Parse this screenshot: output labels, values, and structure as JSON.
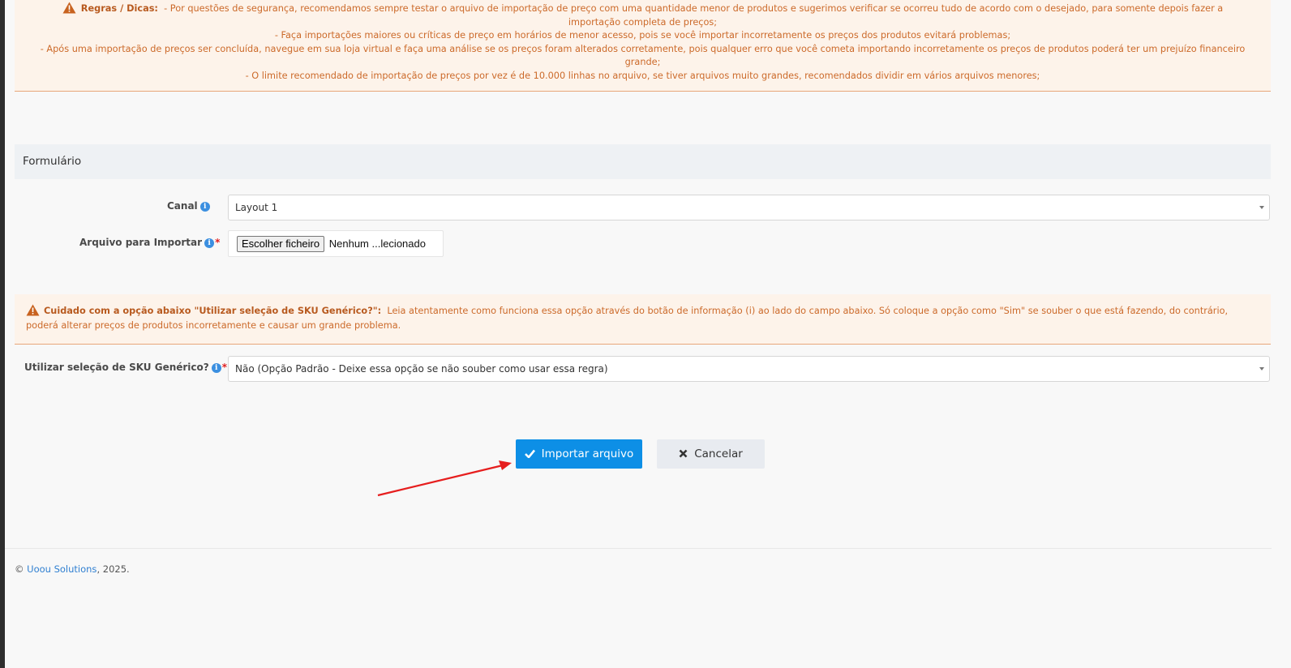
{
  "rules": {
    "title": "Regras / Dicas:",
    "lines": [
      "- Por questões de segurança, recomendamos sempre testar o arquivo de importação de preço com uma quantidade menor de produtos e sugerimos verificar se ocorreu tudo de acordo com o desejado, para somente depois fazer a importação completa de preços;",
      "- Faça importações maiores ou críticas de preço em horários de menor acesso, pois se você importar incorretamente os preços dos produtos evitará problemas;",
      "- Após uma importação de preços ser concluída, navegue em sua loja virtual e faça uma análise se os preços foram alterados corretamente, pois qualquer erro que você cometa importando incorretamente os preços de produtos poderá ter um prejuízo financeiro grande;",
      "- O limite recomendado de importação de preços por vez é de 10.000 linhas no arquivo, se tiver arquivos muito grandes, recomendados dividir em vários arquivos menores;"
    ]
  },
  "section": {
    "title": "Formulário"
  },
  "form": {
    "canal_label": "Canal",
    "canal_value": "Layout 1",
    "arquivo_label": "Arquivo para Importar",
    "file_button": "Escolher ficheiro",
    "file_status": "Nenhum ...lecionado",
    "required_mark": "*",
    "info_glyph": "i",
    "sku_label": "Utilizar seleção de SKU Genérico?",
    "sku_value": "Não (Opção Padrão - Deixe essa opção se não souber como usar essa regra)"
  },
  "caution": {
    "title": "Cuidado com a opção abaixo \"Utilizar seleção de SKU Genérico?\":",
    "text": "Leia atentamente como funciona essa opção através do botão de informação (i) ao lado do campo abaixo. Só coloque a opção como \"Sim\" se souber o que está fazendo, do contrário, poderá alterar preços de produtos incorretamente e causar um grande problema."
  },
  "buttons": {
    "import_label": "Importar arquivo",
    "import_icon": "check-icon",
    "cancel_label": "Cancelar",
    "cancel_icon": "x-icon"
  },
  "footer": {
    "copyright": "©",
    "company": "Uoou Solutions",
    "year_suffix": ", 2025."
  },
  "colors": {
    "warning_bg": "#fdf3ea",
    "warning_text": "#cc6a2a",
    "primary": "#0d8fe6",
    "info": "#3b8fe0",
    "annotation_arrow": "#e61e1e"
  }
}
